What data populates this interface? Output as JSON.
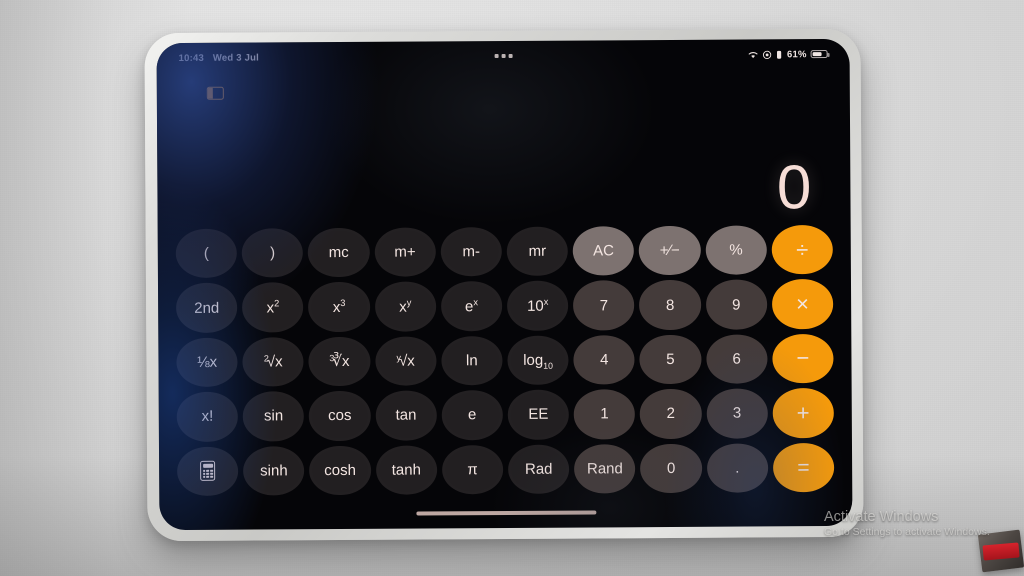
{
  "status_bar": {
    "time": "10:43",
    "date": "Wed 3 Jul",
    "multitask_icon": "three-dots-icon",
    "wifi_icon": "wifi-icon",
    "focus_icon": "focus-moon-icon",
    "signal_icon": "cellular-icon",
    "battery_percent": "61%",
    "battery_level": 61,
    "battery_icon": "battery-icon"
  },
  "multitask_indicator": {
    "icon": "split-view-icon",
    "color": "#e8912a"
  },
  "display": {
    "value": "0"
  },
  "keypad": {
    "rows": [
      [
        {
          "label": "(",
          "name": "key-open-paren",
          "style": "fn"
        },
        {
          "label": ")",
          "name": "key-close-paren",
          "style": "fn"
        },
        {
          "label": "mc",
          "name": "key-memory-clear",
          "style": "fn"
        },
        {
          "label": "m+",
          "name": "key-memory-add",
          "style": "fn"
        },
        {
          "label": "m-",
          "name": "key-memory-subtract",
          "style": "fn"
        },
        {
          "label": "mr",
          "name": "key-memory-recall",
          "style": "fn"
        },
        {
          "label": "AC",
          "name": "key-all-clear",
          "style": "util"
        },
        {
          "label": "+/-",
          "name": "key-sign-toggle",
          "style": "util"
        },
        {
          "label": "%",
          "name": "key-percent",
          "style": "util"
        },
        {
          "label": "÷",
          "name": "key-divide",
          "style": "accent"
        }
      ],
      [
        {
          "label": "2nd",
          "name": "key-second-function",
          "style": "fn"
        },
        {
          "label": "x2",
          "name": "key-square",
          "style": "fn"
        },
        {
          "label": "x3",
          "name": "key-cube",
          "style": "fn"
        },
        {
          "label": "xy",
          "name": "key-power",
          "style": "fn"
        },
        {
          "label": "ex",
          "name": "key-exp-e",
          "style": "fn"
        },
        {
          "label": "10x",
          "name": "key-exp-ten",
          "style": "fn"
        },
        {
          "label": "7",
          "name": "key-7",
          "style": "num"
        },
        {
          "label": "8",
          "name": "key-8",
          "style": "num"
        },
        {
          "label": "9",
          "name": "key-9",
          "style": "num"
        },
        {
          "label": "×",
          "name": "key-multiply",
          "style": "accent"
        }
      ],
      [
        {
          "label": "1/x",
          "name": "key-reciprocal",
          "style": "fn"
        },
        {
          "label": "2root",
          "name": "key-square-root",
          "style": "fn"
        },
        {
          "label": "3root",
          "name": "key-cube-root",
          "style": "fn"
        },
        {
          "label": "yroot",
          "name": "key-nth-root",
          "style": "fn"
        },
        {
          "label": "ln",
          "name": "key-natural-log",
          "style": "fn"
        },
        {
          "label": "log10",
          "name": "key-log-base-ten",
          "style": "fn"
        },
        {
          "label": "4",
          "name": "key-4",
          "style": "num"
        },
        {
          "label": "5",
          "name": "key-5",
          "style": "num"
        },
        {
          "label": "6",
          "name": "key-6",
          "style": "num"
        },
        {
          "label": "−",
          "name": "key-subtract",
          "style": "accent"
        }
      ],
      [
        {
          "label": "x!",
          "name": "key-factorial",
          "style": "fn"
        },
        {
          "label": "sin",
          "name": "key-sin",
          "style": "fn"
        },
        {
          "label": "cos",
          "name": "key-cos",
          "style": "fn"
        },
        {
          "label": "tan",
          "name": "key-tan",
          "style": "fn"
        },
        {
          "label": "e",
          "name": "key-euler",
          "style": "fn"
        },
        {
          "label": "EE",
          "name": "key-scientific-notation",
          "style": "fn"
        },
        {
          "label": "1",
          "name": "key-1",
          "style": "num"
        },
        {
          "label": "2",
          "name": "key-2",
          "style": "num"
        },
        {
          "label": "3",
          "name": "key-3",
          "style": "num"
        },
        {
          "label": "+",
          "name": "key-add",
          "style": "accent"
        }
      ],
      [
        {
          "label": "calculator-icon",
          "name": "key-basic-mode",
          "style": "fn"
        },
        {
          "label": "sinh",
          "name": "key-sinh",
          "style": "fn"
        },
        {
          "label": "cosh",
          "name": "key-cosh",
          "style": "fn"
        },
        {
          "label": "tanh",
          "name": "key-tanh",
          "style": "fn"
        },
        {
          "label": "π",
          "name": "key-pi",
          "style": "fn"
        },
        {
          "label": "Rad",
          "name": "key-radians",
          "style": "fn"
        },
        {
          "label": "Rand",
          "name": "key-random",
          "style": "num"
        },
        {
          "label": "0",
          "name": "key-0",
          "style": "num"
        },
        {
          "label": ".",
          "name": "key-decimal",
          "style": "num"
        },
        {
          "label": "=",
          "name": "key-equals",
          "style": "accent"
        }
      ]
    ]
  },
  "watermark": {
    "title": "Activate Windows",
    "subtitle": "Go to Settings to activate Windows."
  },
  "colors": {
    "accent_orange": "#f59a0b",
    "function_key": "#221f21",
    "number_key": "#443b3a",
    "utility_key": "#7d7270",
    "display_text": "#f6ddd6",
    "multitask_orange": "#e8912a"
  }
}
